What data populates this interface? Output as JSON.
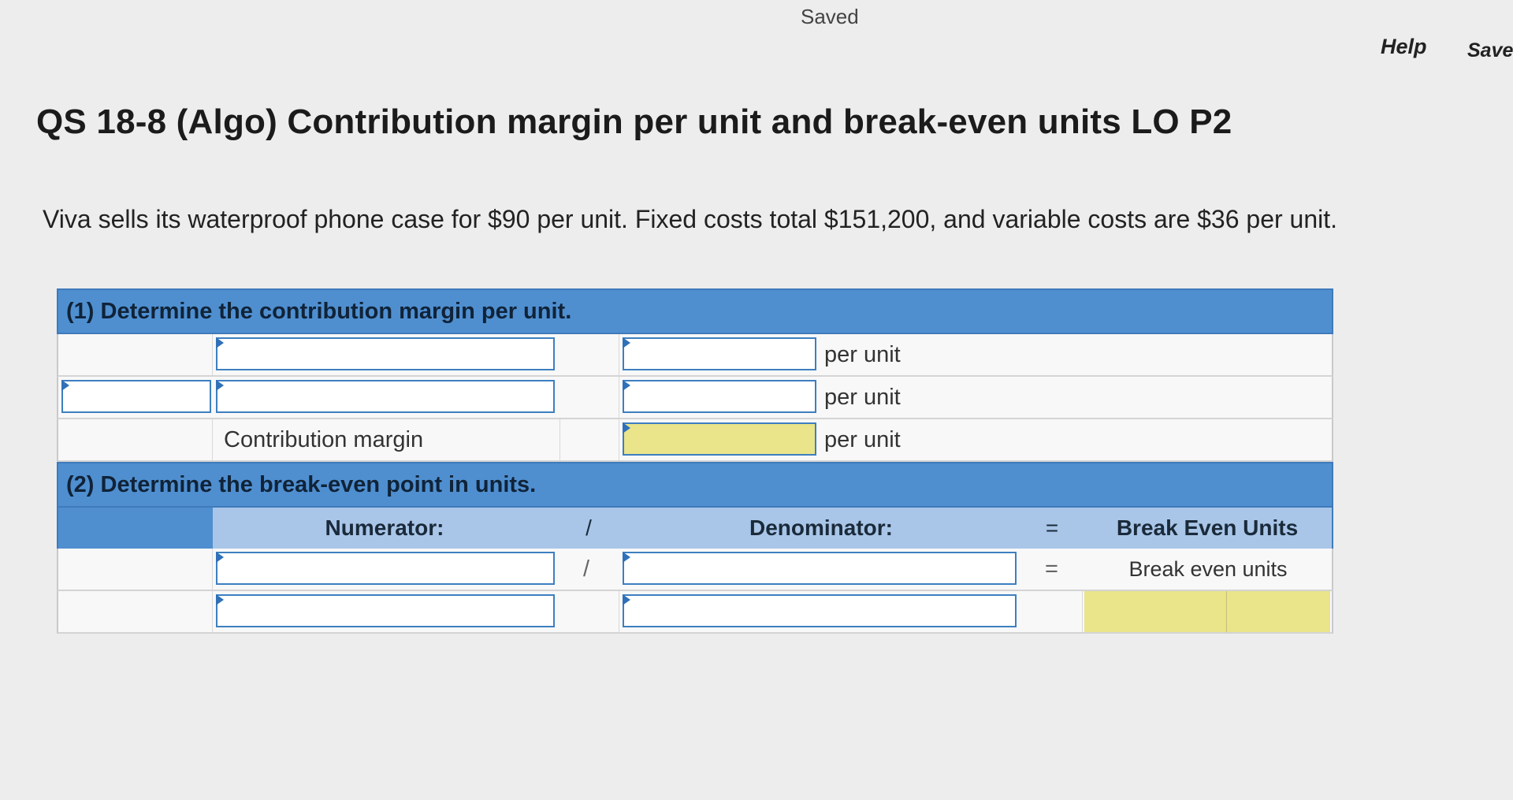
{
  "header": {
    "status": "Saved",
    "help_label": "Help",
    "save_label": "Save"
  },
  "question": {
    "title": "QS 18-8 (Algo) Contribution margin per unit and break-even units LO P2",
    "text": "Viva sells its waterproof phone case for $90 per unit. Fixed costs total $151,200, and variable costs are $36 per unit."
  },
  "part1": {
    "heading": "(1) Determine the contribution margin per unit.",
    "rows": [
      {
        "unit": "per unit"
      },
      {
        "unit": "per unit"
      },
      {
        "label": "Contribution margin",
        "unit": "per unit"
      }
    ]
  },
  "part2": {
    "heading": "(2) Determine the break-even point in units.",
    "col_numerator": "Numerator:",
    "col_slash": "/",
    "col_denominator": "Denominator:",
    "col_equals": "=",
    "col_result": "Break Even Units",
    "row1_slash": "/",
    "row1_equals": "=",
    "row1_result": "Break even units"
  },
  "colors": {
    "section_header": "#4f8fd0",
    "input_border": "#3d7fc0",
    "highlight_yellow": "#eae48a"
  }
}
